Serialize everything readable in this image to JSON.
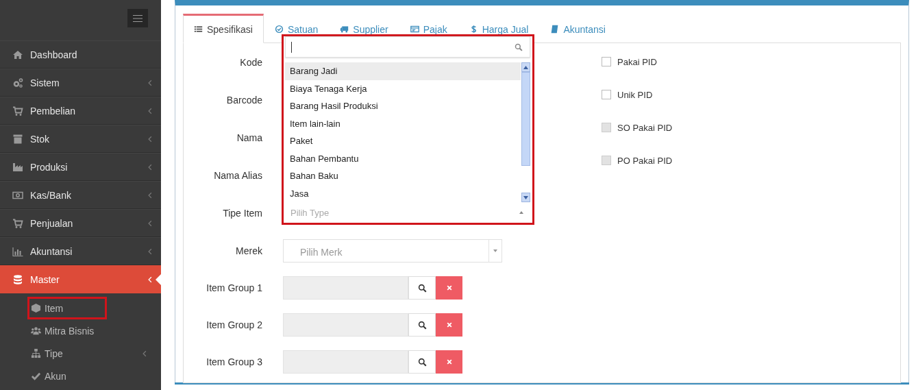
{
  "sidebar": {
    "items": [
      {
        "label": "Dashboard",
        "expandable": false,
        "selected": false
      },
      {
        "label": "Sistem",
        "expandable": true,
        "selected": false
      },
      {
        "label": "Pembelian",
        "expandable": true,
        "selected": false
      },
      {
        "label": "Stok",
        "expandable": true,
        "selected": false
      },
      {
        "label": "Produksi",
        "expandable": true,
        "selected": false
      },
      {
        "label": "Kas/Bank",
        "expandable": true,
        "selected": false
      },
      {
        "label": "Penjualan",
        "expandable": true,
        "selected": false
      },
      {
        "label": "Akuntansi",
        "expandable": true,
        "selected": false
      },
      {
        "label": "Master",
        "expandable": true,
        "selected": true,
        "children": [
          {
            "label": "Item",
            "expandable": false,
            "highlighted": true
          },
          {
            "label": "Mitra Bisnis",
            "expandable": false,
            "highlighted": false
          },
          {
            "label": "Tipe",
            "expandable": true,
            "highlighted": false
          },
          {
            "label": "Akun",
            "expandable": false,
            "highlighted": false
          }
        ]
      }
    ]
  },
  "tabs": [
    {
      "label": "Spesifikasi",
      "selected": true
    },
    {
      "label": "Satuan",
      "selected": false
    },
    {
      "label": "Supplier",
      "selected": false
    },
    {
      "label": "Pajak",
      "selected": false
    },
    {
      "label": "Harga Jual",
      "selected": false
    },
    {
      "label": "Akuntansi",
      "selected": false
    }
  ],
  "form": {
    "fields": [
      {
        "label": "Kode",
        "kind": "covered"
      },
      {
        "label": "Barcode",
        "kind": "covered"
      },
      {
        "label": "Nama",
        "kind": "covered"
      },
      {
        "label": "Nama Alias",
        "kind": "covered"
      },
      {
        "label": "Tipe Item",
        "kind": "covered"
      },
      {
        "label": "Merek",
        "kind": "select",
        "placeholder": "Pilih Merk"
      },
      {
        "label": "Item Group 1",
        "kind": "lookup"
      },
      {
        "label": "Item Group 2",
        "kind": "lookup"
      },
      {
        "label": "Item Group 3",
        "kind": "lookup"
      }
    ]
  },
  "type_dropdown": {
    "highlighted": true,
    "placeholder": "Pilih Type",
    "options": [
      {
        "label": "Barang Jadi",
        "selected": true
      },
      {
        "label": "Biaya Tenaga Kerja",
        "selected": false
      },
      {
        "label": "Barang Hasil Produksi",
        "selected": false
      },
      {
        "label": "Item lain-lain",
        "selected": false
      },
      {
        "label": "Paket",
        "selected": false
      },
      {
        "label": "Bahan Pembantu",
        "selected": false
      },
      {
        "label": "Bahan Baku",
        "selected": false
      },
      {
        "label": "Jasa",
        "selected": false
      }
    ]
  },
  "checkboxes": [
    {
      "label": "Pakai PID",
      "checked": false,
      "disabled": false
    },
    {
      "label": "Unik PID",
      "checked": false,
      "disabled": false
    },
    {
      "label": "SO Pakai PID",
      "checked": false,
      "disabled": true
    },
    {
      "label": "PO Pakai PID",
      "checked": false,
      "disabled": true
    }
  ]
}
